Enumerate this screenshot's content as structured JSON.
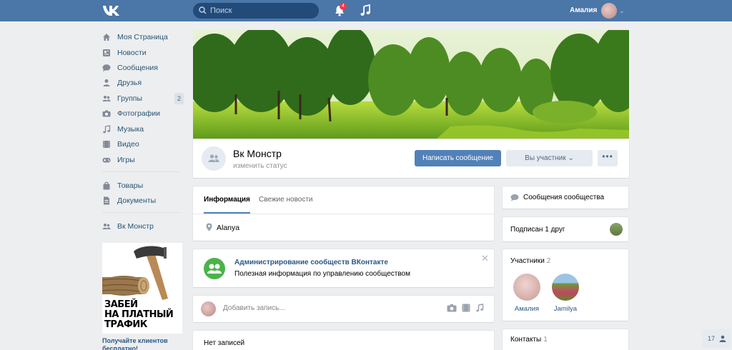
{
  "header": {
    "search_placeholder": "Поиск",
    "notifications_count": "4",
    "user_name": "Амалия",
    "accent": "#4a76a8"
  },
  "sidebar": {
    "items": [
      {
        "label": "Моя Страница",
        "icon": "home-icon"
      },
      {
        "label": "Новости",
        "icon": "news-icon"
      },
      {
        "label": "Сообщения",
        "icon": "messages-icon"
      },
      {
        "label": "Друзья",
        "icon": "friends-icon"
      },
      {
        "label": "Группы",
        "icon": "groups-icon",
        "count": "2"
      },
      {
        "label": "Фотографии",
        "icon": "camera-icon"
      },
      {
        "label": "Музыка",
        "icon": "music-icon"
      },
      {
        "label": "Видео",
        "icon": "video-icon"
      },
      {
        "label": "Игры",
        "icon": "gamepad-icon"
      },
      {
        "label": "Товары",
        "icon": "bag-icon"
      },
      {
        "label": "Документы",
        "icon": "document-icon"
      },
      {
        "label": "Вк Монстр",
        "icon": "group-icon"
      }
    ],
    "ad": {
      "text_line1": "ЗАБЕЙ",
      "text_line2": "НА ПЛАТНЫЙ",
      "text_line3": "ТРАФИК",
      "caption": "Получайте клиентов бесплатно!"
    }
  },
  "group": {
    "title": "Вк Монстр",
    "status": "изменить статус",
    "write_button": "Написать сообщение",
    "member_button": "Вы участник",
    "more_button": "•••"
  },
  "info": {
    "tabs": [
      {
        "label": "Информация",
        "active": true
      },
      {
        "label": "Свежие новости",
        "active": false
      }
    ],
    "location": "Alanya"
  },
  "promo": {
    "title": "Администрирование сообществ ВКонтакте",
    "text": "Полезная информация по управлению сообществом",
    "close": "✕"
  },
  "post": {
    "placeholder": "Добавить запись..."
  },
  "wall": {
    "empty_label": "Нет записей"
  },
  "right": {
    "messages_label": "Сообщения сообщества",
    "friends_label": "Подписан 1 друг",
    "members_title": "Участники",
    "members_count": "2",
    "members": [
      {
        "name": "Амалия"
      },
      {
        "name": "Jamilya"
      }
    ],
    "contacts_title": "Контакты",
    "contacts_count": "1"
  },
  "chat": {
    "count": "17"
  }
}
